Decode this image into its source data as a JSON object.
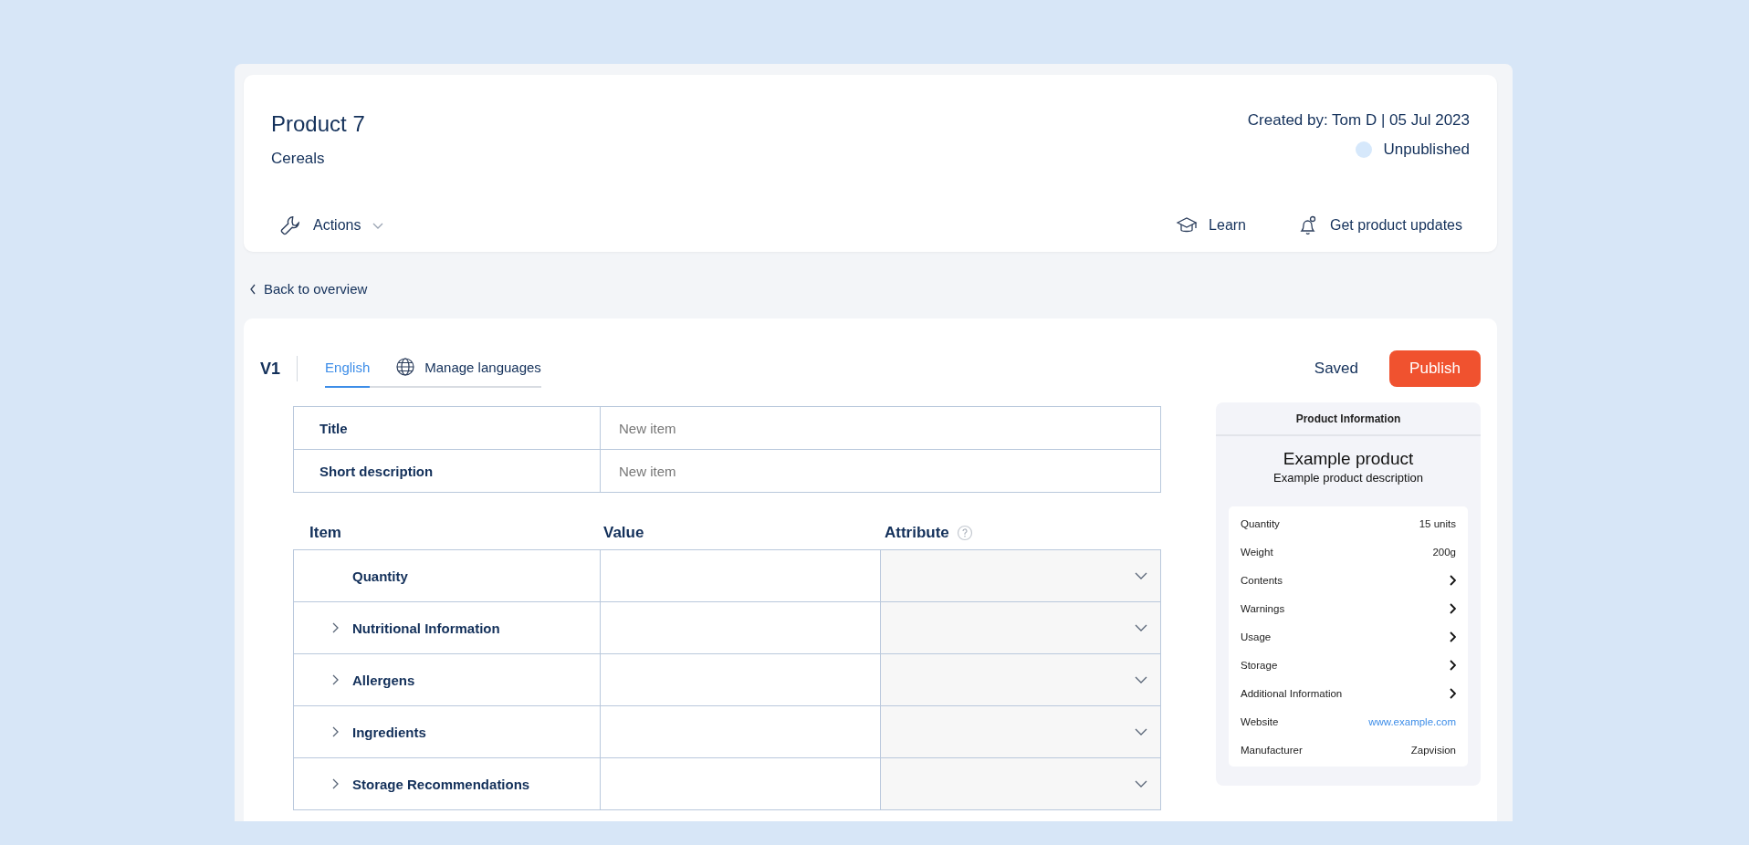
{
  "header": {
    "title": "Product 7",
    "subtitle": "Cereals",
    "created": "Created by: Tom D | 05 Jul 2023",
    "status": {
      "label": "Unpublished",
      "color": "#d6e8fb"
    },
    "actions": "Actions",
    "links": [
      {
        "label": "Learn",
        "kind": "learn"
      },
      {
        "label": "Get product updates",
        "kind": "updates"
      }
    ]
  },
  "back_link": "Back to overview",
  "editor": {
    "version": "V1",
    "tabs": [
      {
        "label": "English",
        "selected": true,
        "kind": "language"
      },
      {
        "label": "Manage languages",
        "selected": false,
        "kind": "manage"
      }
    ],
    "save_state": "Saved",
    "publish": "Publish",
    "fields": [
      {
        "label": "Title",
        "placeholder": "New item"
      },
      {
        "label": "Short description",
        "placeholder": "New item"
      }
    ],
    "table": {
      "columns": [
        "Item",
        "Value",
        "Attribute"
      ],
      "rows": [
        {
          "item": "Quantity",
          "kind": "leaf"
        },
        {
          "item": "Nutritional Information",
          "kind": "group",
          "expanded": false
        },
        {
          "item": "Allergens",
          "kind": "group",
          "expanded": false
        },
        {
          "item": "Ingredients",
          "kind": "group",
          "expanded": false
        },
        {
          "item": "Storage Recommendations",
          "kind": "group",
          "expanded": false
        }
      ]
    }
  },
  "preview": {
    "heading": "Product Information",
    "title": "Example product",
    "description": "Example product description",
    "rows": [
      {
        "label": "Quantity",
        "kind": "value",
        "value": "15 units"
      },
      {
        "label": "Weight",
        "kind": "value",
        "value": "200g"
      },
      {
        "label": "Contents",
        "kind": "more"
      },
      {
        "label": "Warnings",
        "kind": "more"
      },
      {
        "label": "Usage",
        "kind": "more"
      },
      {
        "label": "Storage",
        "kind": "more"
      },
      {
        "label": "Additional Information",
        "kind": "more"
      },
      {
        "label": "Website",
        "kind": "link",
        "value": "www.example.com"
      },
      {
        "label": "Manufacturer",
        "kind": "value",
        "value": "Zapvision"
      }
    ]
  }
}
